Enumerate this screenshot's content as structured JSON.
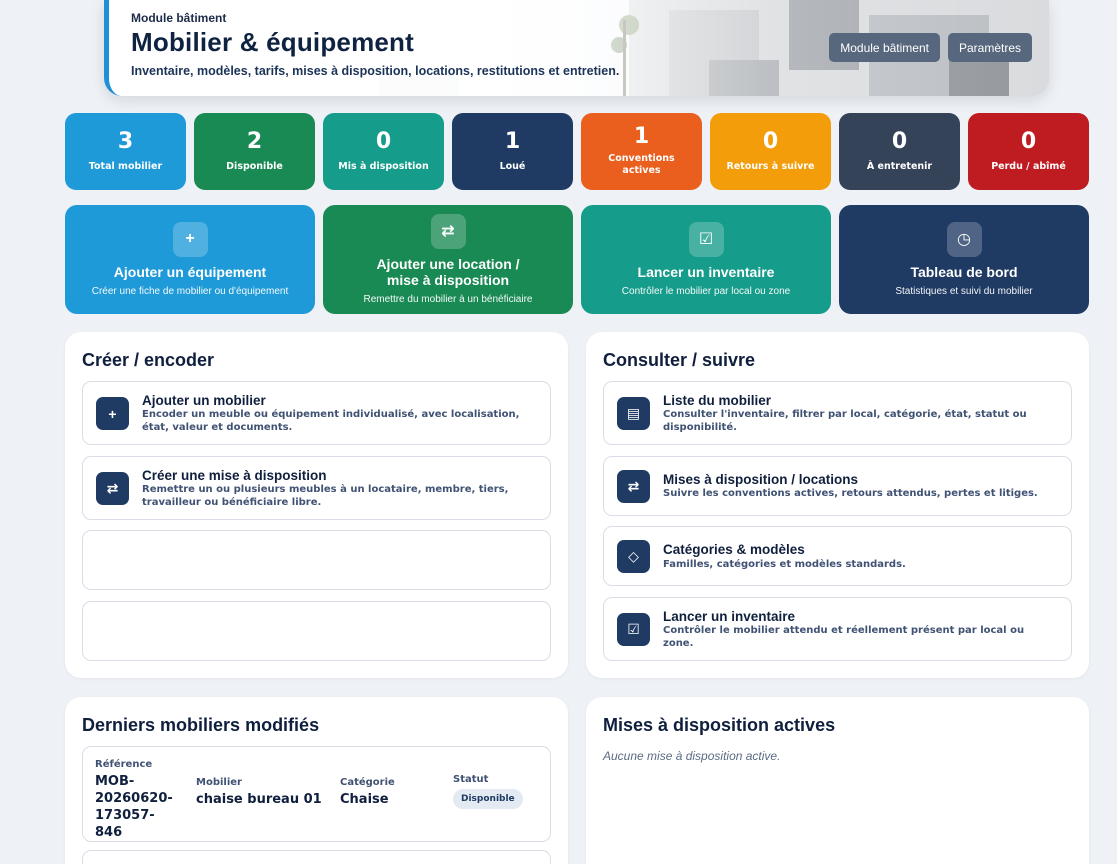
{
  "header": {
    "kicker": "Module bâtiment",
    "title": "Mobilier & équipement",
    "subtitle": "Inventaire, modèles, tarifs, mises à disposition, locations, restitutions et entretien.",
    "actions": [
      {
        "label": "Module bâtiment"
      },
      {
        "label": "Paramètres"
      }
    ]
  },
  "stats": [
    {
      "value": "3",
      "label": "Total mobilier",
      "color": "#1f9ad8"
    },
    {
      "value": "2",
      "label": "Disponible",
      "color": "#1a8a55"
    },
    {
      "value": "0",
      "label": "Mis à disposition",
      "color": "#169c8a"
    },
    {
      "value": "1",
      "label": "Loué",
      "color": "#1f3a63"
    },
    {
      "value": "1",
      "label": "Conventions actives",
      "color": "#ea5f1d"
    },
    {
      "value": "0",
      "label": "Retours à suivre",
      "color": "#f39d0b"
    },
    {
      "value": "0",
      "label": "À entretenir",
      "color": "#344358"
    },
    {
      "value": "0",
      "label": "Perdu / abîmé",
      "color": "#bf1c21"
    }
  ],
  "quick_actions": [
    {
      "icon": "plus-icon",
      "glyph": "+",
      "title": "Ajouter un équipement",
      "subtitle": "Créer une fiche de mobilier ou d'équipement",
      "color": "#1f9ad8"
    },
    {
      "icon": "swap-icon",
      "glyph": "⇄",
      "title": "Ajouter une location / mise à disposition",
      "subtitle": "Remettre du mobilier à un bénéficiaire",
      "color": "#1a8a55"
    },
    {
      "icon": "checkbox-icon",
      "glyph": "☑",
      "title": "Lancer un inventaire",
      "subtitle": "Contrôler le mobilier par local ou zone",
      "color": "#169c8a"
    },
    {
      "icon": "pie-chart-icon",
      "glyph": "◷",
      "title": "Tableau de bord",
      "subtitle": "Statistiques et suivi du mobilier",
      "color": "#1f3a63"
    }
  ],
  "create_panel": {
    "title": "Créer / encoder",
    "items": [
      {
        "icon": "plus-icon",
        "glyph": "+",
        "title": "Ajouter un mobilier",
        "desc": "Encoder un meuble ou équipement individualisé, avec localisation, état, valeur et documents."
      },
      {
        "icon": "swap-icon",
        "glyph": "⇄",
        "title": "Créer une mise à disposition",
        "desc": "Remettre un ou plusieurs meubles à un locataire, membre, tiers, travailleur ou bénéficiaire libre."
      }
    ]
  },
  "consult_panel": {
    "title": "Consulter / suivre",
    "items": [
      {
        "icon": "list-icon",
        "glyph": "▤",
        "title": "Liste du mobilier",
        "desc": "Consulter l'inventaire, filtrer par local, catégorie, état, statut ou disponibilité."
      },
      {
        "icon": "swap-icon",
        "glyph": "⇄",
        "title": "Mises à disposition / locations",
        "desc": "Suivre les conventions actives, retours attendus, pertes et litiges."
      },
      {
        "icon": "diamond-icon",
        "glyph": "◇",
        "title": "Catégories & modèles",
        "desc": "Familles, catégories et modèles standards."
      },
      {
        "icon": "checkbox-icon",
        "glyph": "☑",
        "title": "Lancer un inventaire",
        "desc": "Contrôler le mobilier attendu et réellement présent par local ou zone."
      }
    ]
  },
  "recent_panel": {
    "title": "Derniers mobiliers modifiés",
    "headers": {
      "ref": "Référence",
      "name": "Mobilier",
      "category": "Catégorie",
      "status": "Statut"
    },
    "rows": [
      {
        "ref": "MOB-20260620-173057-846",
        "name": "chaise bureau 01",
        "category": "Chaise",
        "status": "Disponible"
      }
    ]
  },
  "active_panel": {
    "title": "Mises à disposition actives",
    "empty": "Aucune mise à disposition active."
  }
}
